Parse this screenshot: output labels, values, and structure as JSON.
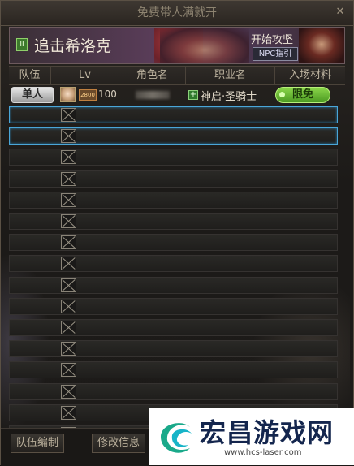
{
  "window": {
    "title": "免费带人满就开",
    "close_label": "✕"
  },
  "banner": {
    "toggle_label": "II",
    "title": "追击希洛克",
    "start_label": "开始攻坚",
    "npc_guide_label": "NPC指引"
  },
  "table": {
    "headers": [
      "队伍",
      "Lv",
      "角色名",
      "职业名",
      "入场材料"
    ],
    "player": {
      "party_badge": "单人",
      "level_icon": "2800",
      "level": "100",
      "class_icon": "+",
      "class_name": "神启·圣骑士",
      "ticket": "限免"
    },
    "empty_rows": 17
  },
  "footer": {
    "buttons": [
      "队伍编制",
      "修改信息"
    ]
  },
  "watermark": {
    "brand": "宏昌游戏网",
    "url": "www.hcs-laser.com"
  },
  "colors": {
    "selected_border": "#4aa6d8",
    "ticket_green": "#6cbc36",
    "brand_navy": "#14264e"
  }
}
